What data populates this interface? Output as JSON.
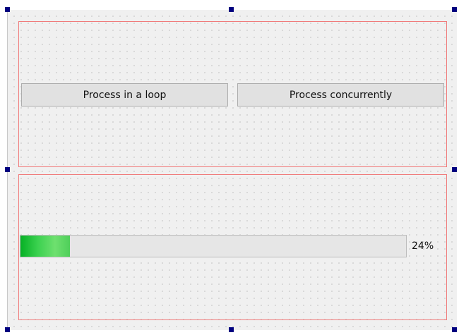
{
  "buttons": {
    "loop_label": "Process in a loop",
    "concurrent_label": "Process concurrently"
  },
  "progress": {
    "value_text": "24%",
    "fraction": 0.24
  },
  "colors": {
    "layout_border": "#f07b7b",
    "selection_handle": "#000080",
    "progress_fill": "#06b025"
  }
}
